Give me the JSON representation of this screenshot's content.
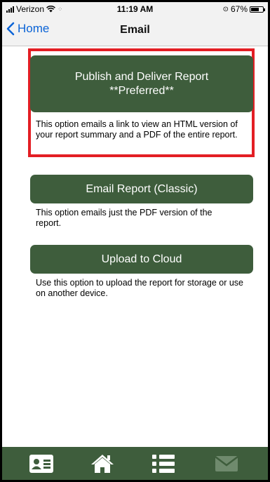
{
  "status_bar": {
    "carrier": "Verizon",
    "time": "11:19 AM",
    "battery": "67%",
    "battery_level": 0.67
  },
  "nav": {
    "back_label": "Home",
    "title": "Email"
  },
  "options": {
    "publish": {
      "title": "Publish and Deliver Report",
      "subtitle": "**Preferred**",
      "description": "This option emails a link to view an HTML version of your report summary and a PDF of the entire report."
    },
    "classic": {
      "title": "Email Report (Classic)",
      "description": "This option emails just the PDF version of the report."
    },
    "cloud": {
      "title": "Upload to Cloud",
      "description": "Use this option to upload the report for storage or use on another device."
    }
  },
  "tab_bar": {
    "icons": [
      "contact-card-icon",
      "home-icon",
      "list-icon",
      "mail-icon"
    ]
  },
  "colors": {
    "accent_green": "#3e5d3c",
    "link_blue": "#0a63d6",
    "highlight_red": "#e31e24"
  }
}
